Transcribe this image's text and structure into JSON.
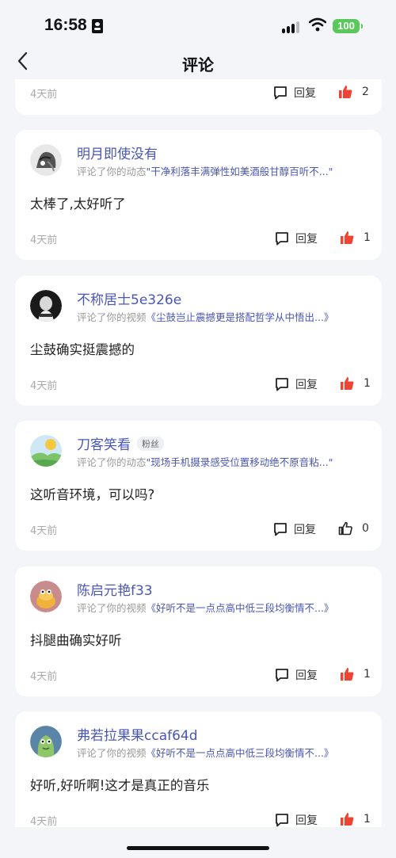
{
  "status_bar": {
    "time": "16:58",
    "battery": "100"
  },
  "nav": {
    "title": "评论"
  },
  "reply_label": "回复",
  "partial_card": {
    "time": "4天前",
    "likes": "2"
  },
  "comments": [
    {
      "name": "明月即使没有",
      "badge": "",
      "action": "评论了你的动态",
      "target": "\"干净利落丰满弹性如美酒般甘醇百听不...\"",
      "text": "太棒了,太好听了",
      "time": "4天前",
      "likes": "1",
      "liked": true
    },
    {
      "name": "不称居士5e326e",
      "badge": "",
      "action": "评论了你的视频",
      "target": "《尘鼓岂止震撼更是搭配哲学从中悟出...》",
      "text": "尘鼓确实挺震撼的",
      "time": "4天前",
      "likes": "1",
      "liked": true
    },
    {
      "name": "刀客笑看",
      "badge": "粉丝",
      "action": "评论了你的动态",
      "target": "\"现场手机摄录感受位置移动绝不原音粘...\"",
      "text": "这听音环境，可以吗?",
      "time": "4天前",
      "likes": "0",
      "liked": false
    },
    {
      "name": "陈启元艳f33",
      "badge": "",
      "action": "评论了你的视频",
      "target": "《好听不是一点点高中低三段均衡情不...》",
      "text": "抖腿曲确实好听",
      "time": "4天前",
      "likes": "1",
      "liked": true
    },
    {
      "name": "弗若拉果果ccaf64d",
      "badge": "",
      "action": "评论了你的视频",
      "target": "《好听不是一点点高中低三段均衡情不...》",
      "text": "好听,好听啊!这才是真正的音乐",
      "time": "4天前",
      "likes": "1",
      "liked": true
    }
  ],
  "colors": {
    "accent": "#4a56b4",
    "like": "#ee4433",
    "background": "#f4f5f9"
  }
}
